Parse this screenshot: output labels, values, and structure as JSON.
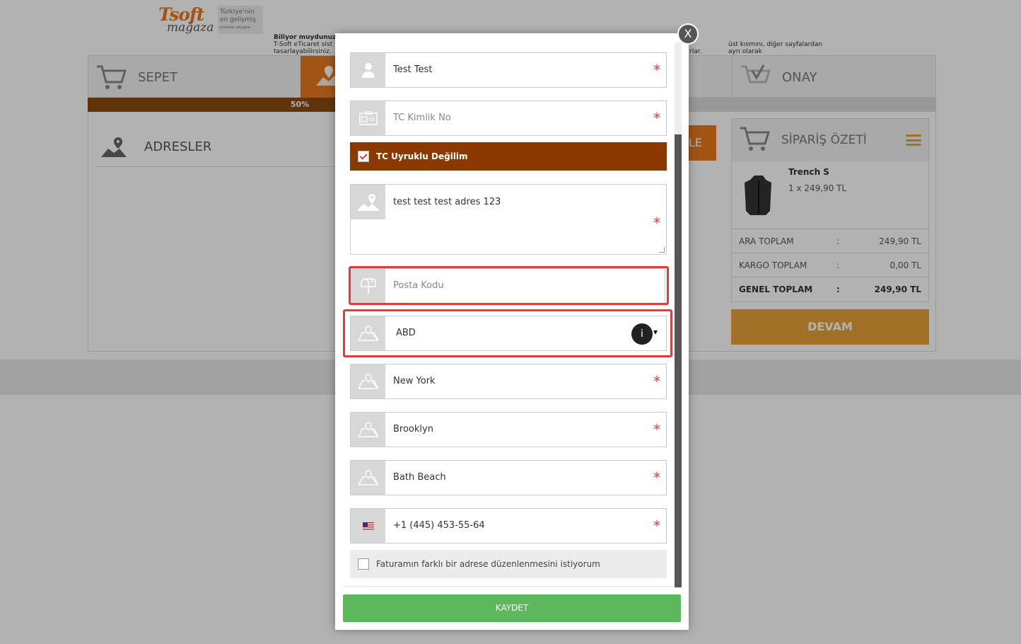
{
  "logo": {
    "brand": "Tsoft",
    "brand_sub": "mağaza",
    "tagline_1": "Türkiye'nin",
    "tagline_2": "en gelişmiş",
    "tagline_3": "e-ticaret altyapısı"
  },
  "tip": {
    "title": "Biliyor muydunuz",
    "line1_start": "T-Soft eTicaret sist",
    "line1_end": "üst kısmını, diğer sayfalardan ayrı olarak",
    "line2_start": "tasarlayabilirsiniz.",
    "line2_end": "rlar."
  },
  "steps": {
    "sepet": "SEPET",
    "onay": "ONAY",
    "progress": "50%"
  },
  "adresler": {
    "title": "ADRESLER",
    "add_button": "LE"
  },
  "summary": {
    "title": "SİPARİŞ ÖZETİ",
    "product_name": "Trench S",
    "product_qty": "1 x 249,90 TL",
    "rows": [
      {
        "label": "ARA TOPLAM",
        "sep": ":",
        "value": "249,90 TL"
      },
      {
        "label": "KARGO TOPLAM",
        "sep": ":",
        "value": "0,00 TL"
      },
      {
        "label": "GENEL TOPLAM",
        "sep": ":",
        "value": "249,90 TL"
      }
    ],
    "continue_button": "DEVAM"
  },
  "modal": {
    "close_label": "X",
    "name": "Test Test",
    "tc_placeholder": "TC Kimlik No",
    "tc_checkbox_label": "TC Uyruklu Değilim",
    "address": "test test test adres 123",
    "postal_placeholder": "Posta Kodu",
    "country": "ABD",
    "info_badge": "i",
    "city": "New York",
    "district": "Brooklyn",
    "neighborhood": "Bath Beach",
    "phone": "+1 (445) 453-55-64",
    "billing_checkbox_label": "Faturamın farklı bir adrese düzenlenmesini istiyorum",
    "save_button": "KAYDET",
    "required_mark": "*"
  },
  "colors": {
    "accent_orange": "#e8791f",
    "progress_brown": "#8a4a10",
    "checkbox_row": "#8a3a00",
    "save_green": "#5cb85c",
    "highlight_red": "#e03c3c"
  },
  "tc_checkbox_checked": true,
  "billing_checkbox_checked": false
}
